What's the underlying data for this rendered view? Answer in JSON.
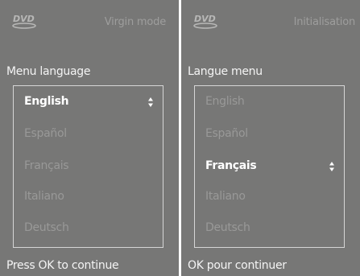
{
  "colors": {
    "screen_background": "#777776",
    "text_primary": "#ffffff",
    "text_dimmed": "#999998",
    "box_border": "#d6d6d6"
  },
  "screens": [
    {
      "logo": "DVD logo",
      "mode_title": "Virgin mode",
      "section_label": "Menu language",
      "options": [
        "English",
        "Español",
        "Français",
        "Italiano",
        "Deutsch"
      ],
      "selected_option": "English",
      "selector_icon": "up-down-arrows-icon",
      "footer": "Press OK to continue"
    },
    {
      "logo": "DVD logo",
      "mode_title": "Initialisation",
      "section_label": "Langue menu",
      "options": [
        "English",
        "Español",
        "Français",
        "Italiano",
        "Deutsch"
      ],
      "selected_option": "Français",
      "selector_icon": "up-down-arrows-icon",
      "footer": "OK pour continuer"
    }
  ]
}
